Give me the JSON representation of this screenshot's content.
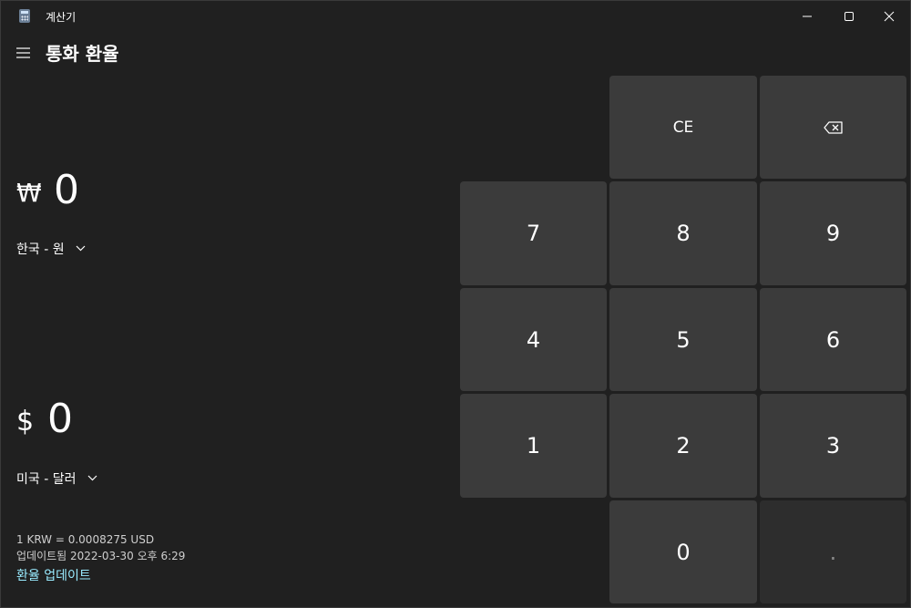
{
  "titlebar": {
    "app_title": "계산기",
    "icons": [
      "calculator-app-icon",
      "minimize-icon",
      "maximize-icon",
      "close-icon"
    ]
  },
  "header": {
    "title": "통화 환율"
  },
  "from": {
    "symbol": "₩",
    "value": "0",
    "currency": "한국 - 원"
  },
  "to": {
    "symbol": "$",
    "value": "0",
    "currency": "미국 - 달러"
  },
  "footer": {
    "rate": "1 KRW = 0.0008275 USD",
    "updated": "업데이트됨 2022-03-30 오후 6:29",
    "update_link": "환율 업데이트"
  },
  "keypad": {
    "ce": "CE",
    "backspace_icon": "backspace-icon",
    "k7": "7",
    "k8": "8",
    "k9": "9",
    "k4": "4",
    "k5": "5",
    "k6": "6",
    "k1": "1",
    "k2": "2",
    "k3": "3",
    "k0": "0",
    "decimal": "."
  },
  "colors": {
    "background": "#202020",
    "key": "#3b3b3b",
    "key_dim": "#2d2d2d",
    "link": "#99ebff"
  }
}
